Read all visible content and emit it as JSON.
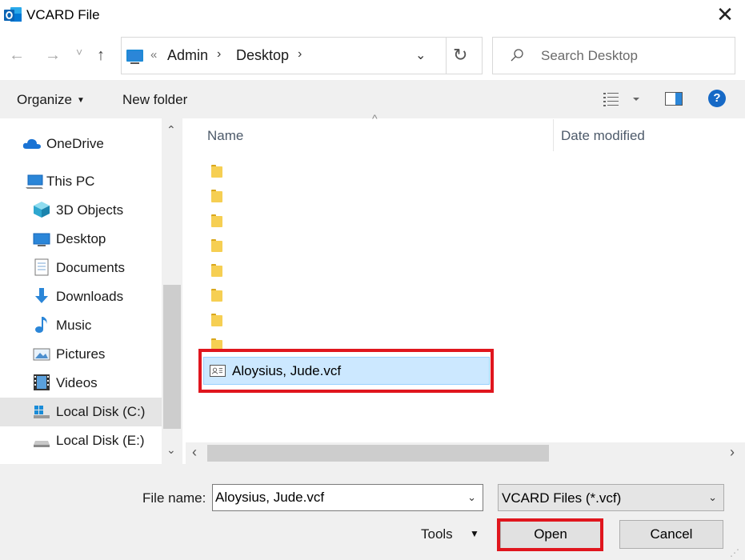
{
  "window": {
    "title": "VCARD File",
    "close_glyph": "✕"
  },
  "address": {
    "back_glyph": "←",
    "forward_glyph": "→",
    "recent_glyph": "˅",
    "up_glyph": "↑",
    "overflow": "«",
    "crumbs": [
      "Admin",
      "Desktop"
    ],
    "separator": "›",
    "dropdown_glyph": "⌄",
    "refresh_glyph": "↻"
  },
  "search": {
    "placeholder": "Search Desktop"
  },
  "toolbar": {
    "organize_label": "Organize",
    "organize_caret": "▼",
    "new_folder_label": "New folder",
    "help_label": "?"
  },
  "nav": {
    "items": [
      {
        "label": "OneDrive",
        "icon": "cloud-icon"
      },
      {
        "label": "This PC",
        "icon": "computer-icon"
      },
      {
        "label": "3D Objects",
        "icon": "cube-icon"
      },
      {
        "label": "Desktop",
        "icon": "desktop-icon"
      },
      {
        "label": "Documents",
        "icon": "document-icon"
      },
      {
        "label": "Downloads",
        "icon": "download-arrow-icon"
      },
      {
        "label": "Music",
        "icon": "music-note-icon"
      },
      {
        "label": "Pictures",
        "icon": "picture-icon"
      },
      {
        "label": "Videos",
        "icon": "film-icon"
      },
      {
        "label": "Local Disk (C:)",
        "icon": "windows-drive-icon",
        "selected": true
      },
      {
        "label": "Local Disk (E:)",
        "icon": "drive-icon"
      }
    ],
    "scroll_up_glyph": "⌃",
    "scroll_down_glyph": "⌄"
  },
  "files": {
    "sort_glyph": "^",
    "columns": [
      "Name",
      "Date modified"
    ],
    "folder_count": 8,
    "selected_file": "Aloysius, Jude.vcf",
    "scroll_left_glyph": "‹",
    "scroll_right_glyph": "›"
  },
  "bottom": {
    "file_name_label": "File name:",
    "file_name_value": "Aloysius, Jude.vcf",
    "file_name_caret": "⌄",
    "file_type": "VCARD Files (*.vcf)",
    "file_type_caret": "⌄",
    "tools_label": "Tools",
    "tools_caret": "▼",
    "open_label": "Open",
    "cancel_label": "Cancel",
    "grip_glyph": "⋰"
  },
  "colors": {
    "highlight": "#e0161e",
    "selection": "#cce8ff",
    "accent": "#1669c6"
  }
}
